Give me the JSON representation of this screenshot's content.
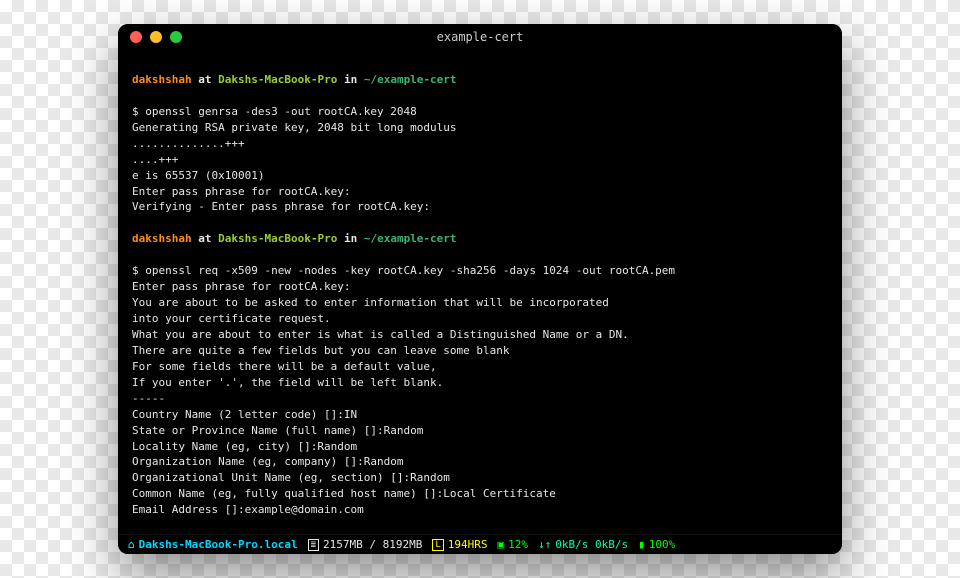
{
  "window": {
    "title": "example-cert"
  },
  "prompt": {
    "user": "dakshshah",
    "at": "at",
    "host": "Dakshs-MacBook-Pro",
    "in": "in",
    "path": "~/example-cert",
    "symbol": "$"
  },
  "block1": {
    "cmd": "openssl genrsa -des3 -out rootCA.key 2048",
    "out1": "Generating RSA private key, 2048 bit long modulus",
    "out2": "..............+++",
    "out3": "....+++",
    "out4": "e is 65537 (0x10001)",
    "out5": "Enter pass phrase for rootCA.key:",
    "out6": "Verifying - Enter pass phrase for rootCA.key:"
  },
  "block2": {
    "cmd": "openssl req -x509 -new -nodes -key rootCA.key -sha256 -days 1024 -out rootCA.pem",
    "out1": "Enter pass phrase for rootCA.key:",
    "out2": "You are about to be asked to enter information that will be incorporated",
    "out3": "into your certificate request.",
    "out4": "What you are about to enter is what is called a Distinguished Name or a DN.",
    "out5": "There are quite a few fields but you can leave some blank",
    "out6": "For some fields there will be a default value,",
    "out7": "If you enter '.', the field will be left blank.",
    "out8": "-----",
    "out9": "Country Name (2 letter code) []:IN",
    "out10": "State or Province Name (full name) []:Random",
    "out11": "Locality Name (eg, city) []:Random",
    "out12": "Organization Name (eg, company) []:Random",
    "out13": "Organizational Unit Name (eg, section) []:Random",
    "out14": "Common Name (eg, fully qualified host name) []:Local Certificate",
    "out15": "Email Address []:example@domain.com"
  },
  "statusbar": {
    "host": "Dakshs-MacBook-Pro.local",
    "mem": "2157MB / 8192MB",
    "hours": "194HRS",
    "pct1": "12%",
    "net": "0kB/s 0kB/s",
    "batt": "100%"
  }
}
